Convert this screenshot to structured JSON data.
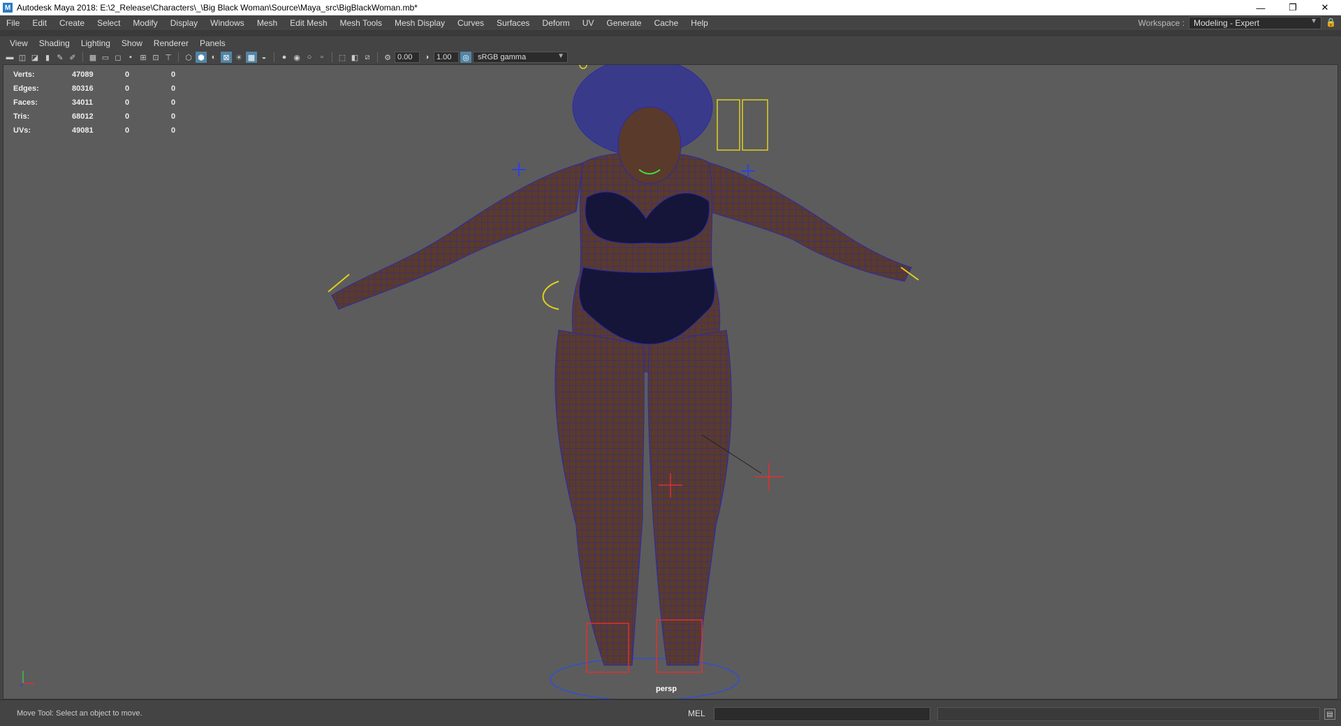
{
  "window": {
    "title": "Autodesk Maya 2018: E:\\2_Release\\Characters\\_\\Big Black Woman\\Source\\Maya_src\\BigBlackWoman.mb*",
    "minimize": "—",
    "restore": "❐",
    "close": "✕"
  },
  "menubar": [
    "File",
    "Edit",
    "Create",
    "Select",
    "Modify",
    "Display",
    "Windows",
    "Mesh",
    "Edit Mesh",
    "Mesh Tools",
    "Mesh Display",
    "Curves",
    "Surfaces",
    "Deform",
    "UV",
    "Generate",
    "Cache",
    "Help"
  ],
  "workspace": {
    "label": "Workspace :",
    "value": "Modeling - Expert"
  },
  "panel_menu": [
    "View",
    "Shading",
    "Lighting",
    "Show",
    "Renderer",
    "Panels"
  ],
  "toolbar": {
    "exposure": "0.00",
    "gamma": "1.00",
    "colorspace": "sRGB gamma"
  },
  "hud": {
    "rows": [
      {
        "label": "Verts:",
        "value": "47089",
        "a": "0",
        "b": "0"
      },
      {
        "label": "Edges:",
        "value": "80316",
        "a": "0",
        "b": "0"
      },
      {
        "label": "Faces:",
        "value": "34011",
        "a": "0",
        "b": "0"
      },
      {
        "label": "Tris:",
        "value": "68012",
        "a": "0",
        "b": "0"
      },
      {
        "label": "UVs:",
        "value": "49081",
        "a": "0",
        "b": "0"
      }
    ]
  },
  "viewport": {
    "camera": "persp",
    "background": "#5c5c5c",
    "mesh_color": "#5a3a2a",
    "wire_color": "#2a2aaa"
  },
  "helpline": {
    "text": "Move Tool: Select an object to move.",
    "mel_label": "MEL"
  }
}
